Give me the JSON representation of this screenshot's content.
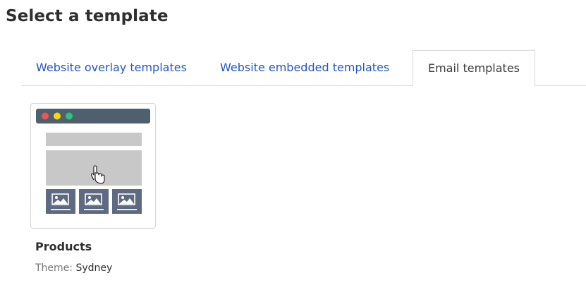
{
  "page_title": "Select a template",
  "tabs": [
    {
      "label": "Website overlay templates",
      "active": false
    },
    {
      "label": "Website embedded templates",
      "active": false
    },
    {
      "label": "Email templates",
      "active": true
    }
  ],
  "templates": [
    {
      "name": "Products",
      "theme_label": "Theme:",
      "theme_value": "Sydney"
    }
  ],
  "colors": {
    "link": "#2356c6",
    "window_bar": "#4e5f6e",
    "dot_red": "#e8584f",
    "dot_yellow": "#f6d70f",
    "dot_green": "#2ec27e",
    "placeholder": "#c8c8c8",
    "image_tile": "#5d6a82"
  }
}
